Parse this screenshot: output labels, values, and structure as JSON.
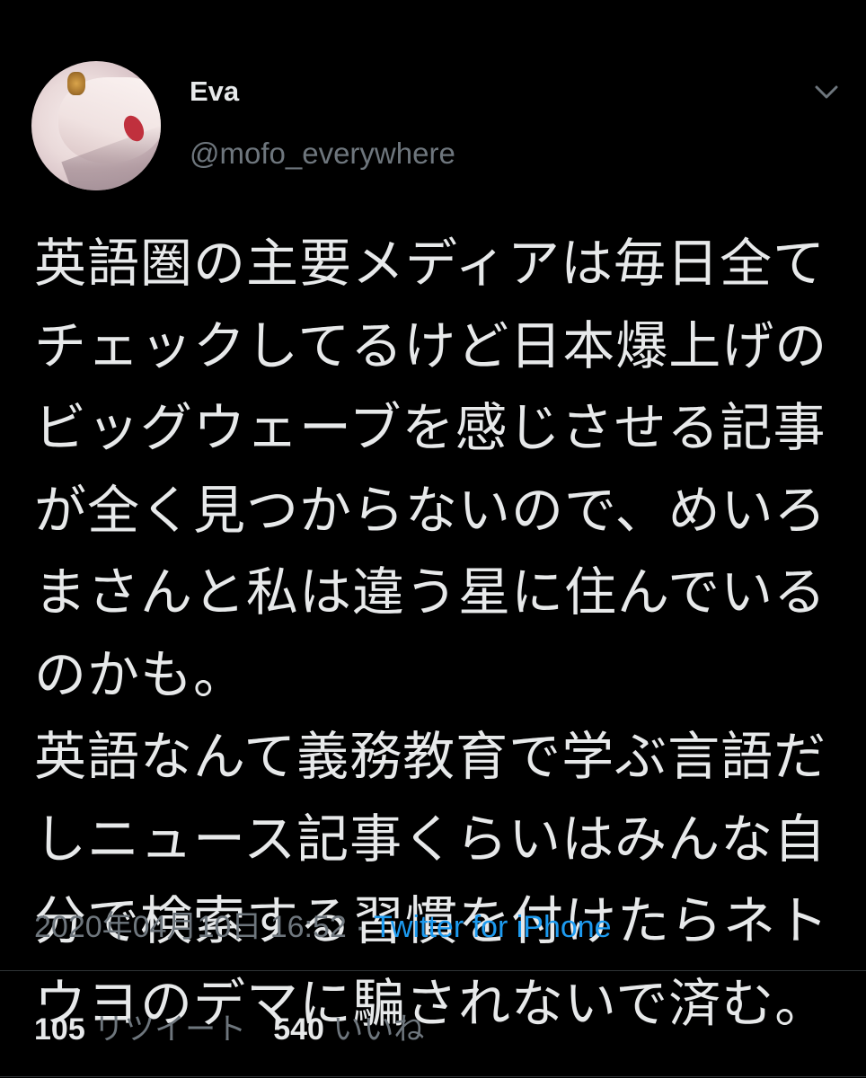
{
  "author": {
    "display_name": "Eva",
    "handle": "@mofo_everywhere"
  },
  "menu_icon": "chevron-down-icon",
  "tweet": {
    "lines": [
      "英語圏の主要メディアは毎日全て",
      "チェックしてるけど日本爆上げの",
      "ビッグウェーブを感じさせる記事",
      "が全く見つからないので、めいろ",
      "まさんと私は違う星に住んでいる",
      "のかも。",
      "英語なんて義務教育で学ぶ言語だ",
      "しニュース記事くらいはみんな自",
      "分で検索する習慣を付けたらネト",
      "ウヨのデマに騙されないで済む。"
    ]
  },
  "meta": {
    "timestamp": "2020年04月10日 16:52",
    "separator": " · ",
    "source": "Twitter for iPhone"
  },
  "stats": {
    "retweets_count": "105",
    "retweets_label": "リツイート",
    "likes_count": "540",
    "likes_label": "いいね"
  },
  "colors": {
    "background": "#000000",
    "text": "#e7e9ea",
    "muted": "#6e767d",
    "link": "#1d9bf0"
  }
}
